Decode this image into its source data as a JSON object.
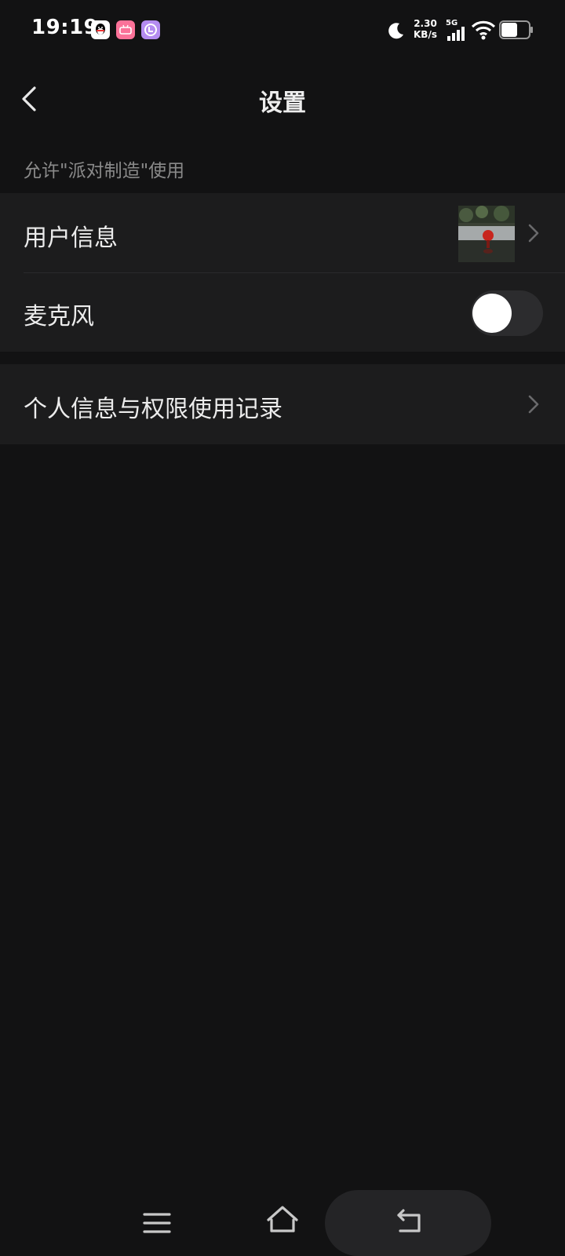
{
  "status_bar": {
    "time": "19:19",
    "net_speed_value": "2.30",
    "net_speed_unit": "KB/s",
    "network_type": "5G",
    "notification_icons": [
      "qq-icon",
      "bilibili-icon",
      "app-icon"
    ]
  },
  "header": {
    "title": "设置",
    "back_icon": "back-arrow-icon"
  },
  "section": {
    "caption": "允许\"派对制造\"使用"
  },
  "rows": {
    "user_info": {
      "label": "用户信息",
      "icon": "chevron-right-icon"
    },
    "microphone": {
      "label": "麦克风",
      "toggle_on": false
    },
    "records": {
      "label": "个人信息与权限使用记录",
      "icon": "chevron-right-icon"
    }
  },
  "nav": {
    "menu_icon": "menu-icon",
    "home_icon": "home-icon",
    "back_icon": "back-icon"
  },
  "colors": {
    "background": "#121213",
    "card": "#1c1c1d",
    "text": "#ececec",
    "caption": "#8a8a8a",
    "toggle_track": "#2c2c2e",
    "bili_pink": "#fb7299"
  }
}
